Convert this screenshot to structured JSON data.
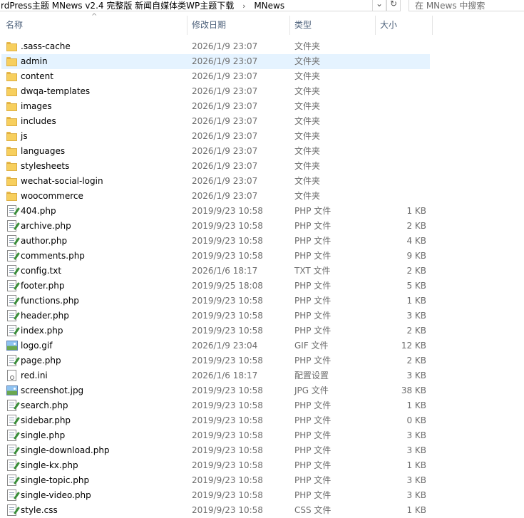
{
  "address": {
    "path": [
      "rdPress主题 MNews v2.4 完整版 新闻自媒体类WP主题下载",
      "MNews"
    ],
    "separator": "›",
    "dropdown_glyph": "⌄",
    "refresh_glyph": "↻"
  },
  "search": {
    "placeholder": "在 MNews 中搜索"
  },
  "columns": {
    "name": "名称",
    "date": "修改日期",
    "type": "类型",
    "size": "大小",
    "sort_glyph": "^"
  },
  "files": [
    {
      "name": ".sass-cache",
      "date": "2026/1/9 23:07",
      "type": "文件夹",
      "size": "",
      "icon": "folder-icon"
    },
    {
      "name": "admin",
      "date": "2026/1/9 23:07",
      "type": "文件夹",
      "size": "",
      "icon": "folder-icon",
      "selected": true
    },
    {
      "name": "content",
      "date": "2026/1/9 23:07",
      "type": "文件夹",
      "size": "",
      "icon": "folder-icon"
    },
    {
      "name": "dwqa-templates",
      "date": "2026/1/9 23:07",
      "type": "文件夹",
      "size": "",
      "icon": "folder-icon"
    },
    {
      "name": "images",
      "date": "2026/1/9 23:07",
      "type": "文件夹",
      "size": "",
      "icon": "folder-icon"
    },
    {
      "name": "includes",
      "date": "2026/1/9 23:07",
      "type": "文件夹",
      "size": "",
      "icon": "folder-icon"
    },
    {
      "name": "js",
      "date": "2026/1/9 23:07",
      "type": "文件夹",
      "size": "",
      "icon": "folder-icon"
    },
    {
      "name": "languages",
      "date": "2026/1/9 23:07",
      "type": "文件夹",
      "size": "",
      "icon": "folder-icon"
    },
    {
      "name": "stylesheets",
      "date": "2026/1/9 23:07",
      "type": "文件夹",
      "size": "",
      "icon": "folder-icon"
    },
    {
      "name": "wechat-social-login",
      "date": "2026/1/9 23:07",
      "type": "文件夹",
      "size": "",
      "icon": "folder-icon"
    },
    {
      "name": "woocommerce",
      "date": "2026/1/9 23:07",
      "type": "文件夹",
      "size": "",
      "icon": "folder-icon"
    },
    {
      "name": "404.php",
      "date": "2019/9/23 10:58",
      "type": "PHP 文件",
      "size": "1 KB",
      "icon": "php-file-icon"
    },
    {
      "name": "archive.php",
      "date": "2019/9/23 10:58",
      "type": "PHP 文件",
      "size": "2 KB",
      "icon": "php-file-icon"
    },
    {
      "name": "author.php",
      "date": "2019/9/23 10:58",
      "type": "PHP 文件",
      "size": "4 KB",
      "icon": "php-file-icon"
    },
    {
      "name": "comments.php",
      "date": "2019/9/23 10:58",
      "type": "PHP 文件",
      "size": "9 KB",
      "icon": "php-file-icon"
    },
    {
      "name": "config.txt",
      "date": "2026/1/6 18:17",
      "type": "TXT 文件",
      "size": "2 KB",
      "icon": "text-file-icon"
    },
    {
      "name": "footer.php",
      "date": "2019/9/25 18:08",
      "type": "PHP 文件",
      "size": "5 KB",
      "icon": "php-file-icon"
    },
    {
      "name": "functions.php",
      "date": "2019/9/23 10:58",
      "type": "PHP 文件",
      "size": "1 KB",
      "icon": "php-file-icon"
    },
    {
      "name": "header.php",
      "date": "2019/9/23 10:58",
      "type": "PHP 文件",
      "size": "3 KB",
      "icon": "php-file-icon"
    },
    {
      "name": "index.php",
      "date": "2019/9/23 10:58",
      "type": "PHP 文件",
      "size": "2 KB",
      "icon": "php-file-icon"
    },
    {
      "name": "logo.gif",
      "date": "2026/1/9 23:04",
      "type": "GIF 文件",
      "size": "12 KB",
      "icon": "image-file-icon"
    },
    {
      "name": "page.php",
      "date": "2019/9/23 10:58",
      "type": "PHP 文件",
      "size": "2 KB",
      "icon": "php-file-icon"
    },
    {
      "name": "red.ini",
      "date": "2026/1/6 18:17",
      "type": "配置设置",
      "size": "3 KB",
      "icon": "ini-file-icon"
    },
    {
      "name": "screenshot.jpg",
      "date": "2019/9/23 10:58",
      "type": "JPG 文件",
      "size": "38 KB",
      "icon": "image-file-icon"
    },
    {
      "name": "search.php",
      "date": "2019/9/23 10:58",
      "type": "PHP 文件",
      "size": "1 KB",
      "icon": "php-file-icon"
    },
    {
      "name": "sidebar.php",
      "date": "2019/9/23 10:58",
      "type": "PHP 文件",
      "size": "0 KB",
      "icon": "php-file-icon"
    },
    {
      "name": "single.php",
      "date": "2019/9/23 10:58",
      "type": "PHP 文件",
      "size": "3 KB",
      "icon": "php-file-icon"
    },
    {
      "name": "single-download.php",
      "date": "2019/9/23 10:58",
      "type": "PHP 文件",
      "size": "3 KB",
      "icon": "php-file-icon"
    },
    {
      "name": "single-kx.php",
      "date": "2019/9/23 10:58",
      "type": "PHP 文件",
      "size": "1 KB",
      "icon": "php-file-icon"
    },
    {
      "name": "single-topic.php",
      "date": "2019/9/23 10:58",
      "type": "PHP 文件",
      "size": "3 KB",
      "icon": "php-file-icon"
    },
    {
      "name": "single-video.php",
      "date": "2019/9/23 10:58",
      "type": "PHP 文件",
      "size": "3 KB",
      "icon": "php-file-icon"
    },
    {
      "name": "style.css",
      "date": "2019/9/23 10:58",
      "type": "CSS 文件",
      "size": "1 KB",
      "icon": "css-file-icon"
    }
  ]
}
